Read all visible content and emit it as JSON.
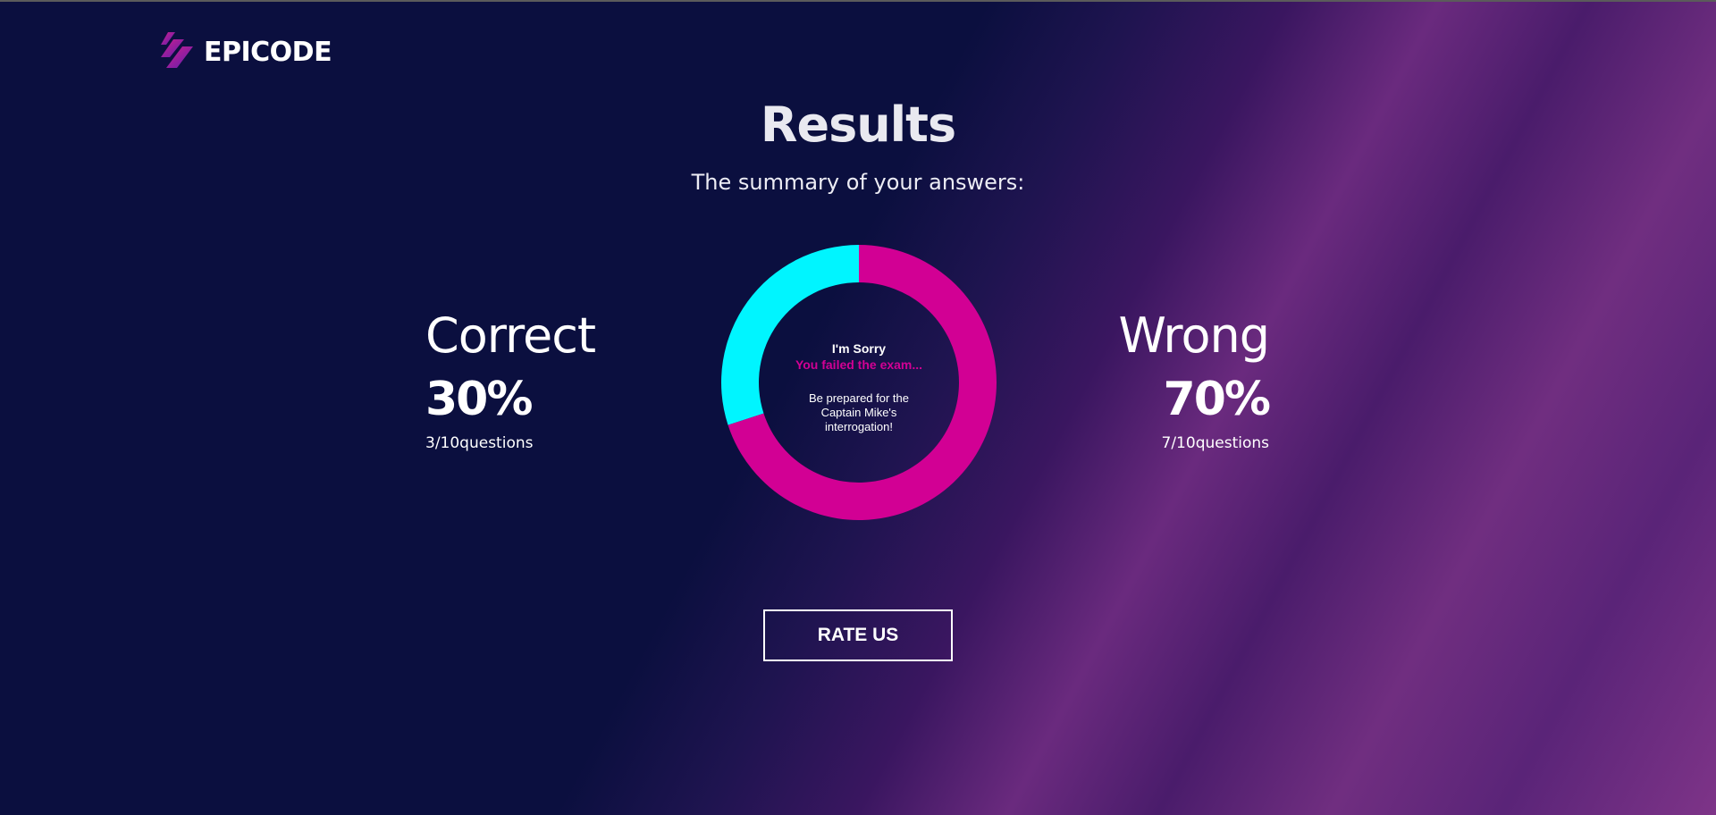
{
  "brand": {
    "name": "EPICODE",
    "icon": "epicode-logo-icon"
  },
  "header": {
    "title": "Results",
    "subtitle": "The summary of your answers:"
  },
  "correct": {
    "label": "Correct",
    "percent": "30%",
    "count": "3/10questions"
  },
  "wrong": {
    "label": "Wrong",
    "percent": "70%",
    "count": "7/10questions"
  },
  "result": {
    "heading": "I'm Sorry",
    "status": "You failed the exam...",
    "message": "Be prepared for the Captain Mike's interrogation!"
  },
  "chart_data": {
    "type": "pie",
    "categories": [
      "Correct",
      "Wrong"
    ],
    "values": [
      30,
      70
    ],
    "colors": [
      "#00f5ff",
      "#d20094"
    ]
  },
  "actions": {
    "rate_label": "RATE US"
  },
  "colors": {
    "background": "#0b0f3f",
    "accent_magenta": "#d20094",
    "accent_cyan": "#00f5ff"
  }
}
